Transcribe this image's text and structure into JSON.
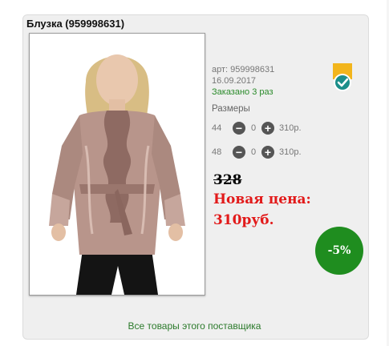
{
  "product": {
    "title": "Блузка (959998631)",
    "article_label": "арт: 959998631",
    "date": "16.09.2017",
    "ordered": "Заказано 3 раз",
    "sizes_heading": "Размеры",
    "sizes": [
      {
        "size": "44",
        "qty": "0",
        "price": "310р."
      },
      {
        "size": "48",
        "qty": "0",
        "price": "310р."
      }
    ],
    "old_price": "328",
    "new_price_label": "Новая цена:",
    "new_price": "310руб.",
    "discount": "-5%",
    "supplier_link": "Все товары этого поставщика"
  },
  "icons": {
    "minus": "minus-icon",
    "plus": "plus-icon",
    "badge": "checkmark-badge-icon"
  },
  "colors": {
    "accent_green": "#1f8d1f",
    "price_red": "#e21a1a",
    "badge_yellow": "#f2b51c",
    "badge_teal": "#1b8e8a"
  }
}
